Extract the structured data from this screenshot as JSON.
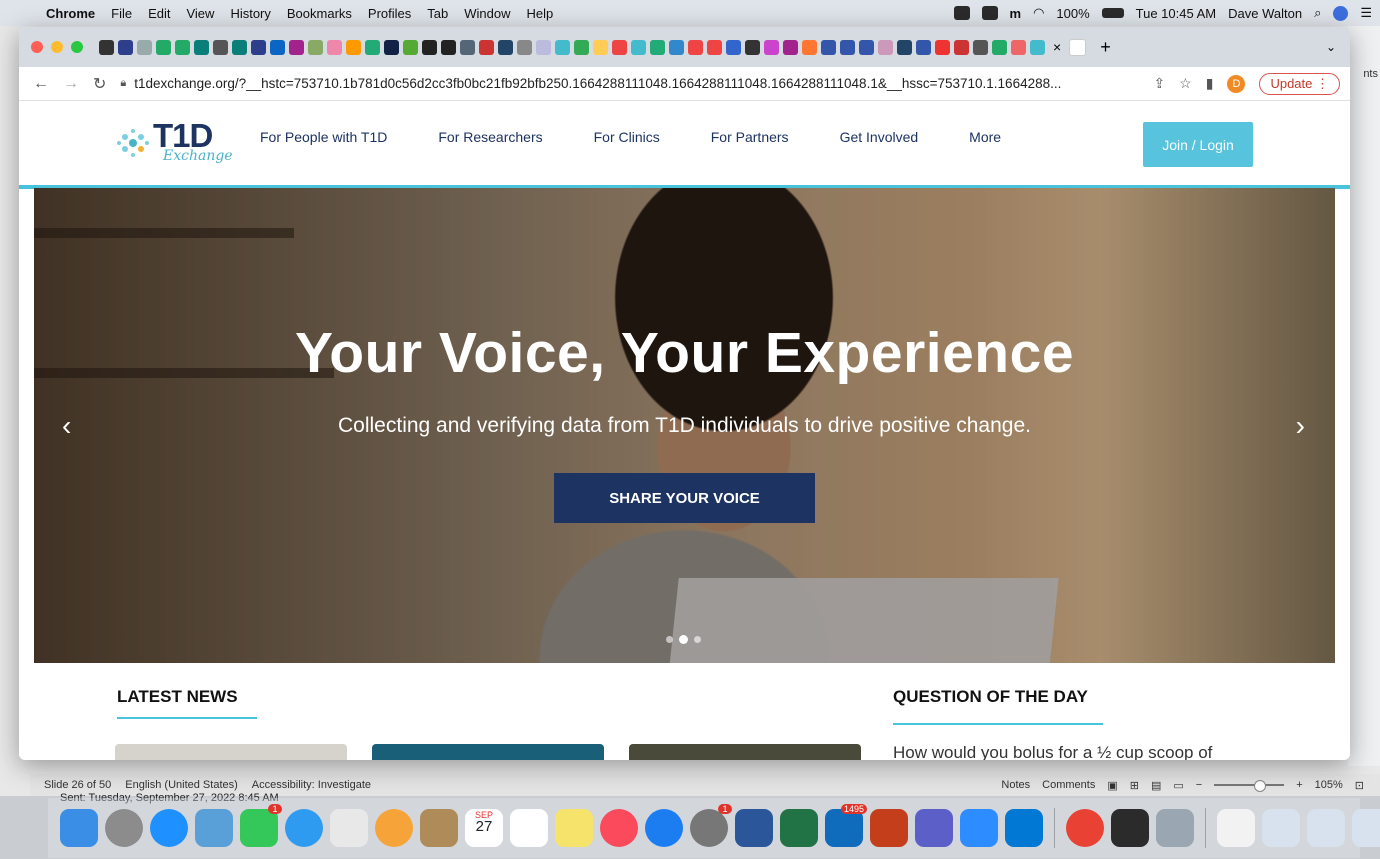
{
  "menubar": {
    "app": "Chrome",
    "items": [
      "File",
      "Edit",
      "View",
      "History",
      "Bookmarks",
      "Profiles",
      "Tab",
      "Window",
      "Help"
    ],
    "battery": "100%",
    "clock": "Tue 10:45 AM",
    "user": "Dave Walton"
  },
  "browser": {
    "url": "t1dexchange.org/?__hstc=753710.1b781d0c56d2cc3fb0bc21fb92bfb250.1664288111048.1664288111048.1664288111048.1&__hssc=753710.1.1664288...",
    "profile_initial": "D",
    "update_label": "Update"
  },
  "site": {
    "logo_main": "T1D",
    "logo_sub": "Exchange",
    "nav": [
      "For People with T1D",
      "For Researchers",
      "For Clinics",
      "For Partners",
      "Get Involved",
      "More"
    ],
    "join_label": "Join / Login",
    "hero": {
      "title": "Your Voice, Your Experience",
      "subtitle": "Collecting and verifying data from T1D individuals to drive positive change.",
      "cta": "SHARE YOUR VOICE",
      "slides_total": 3,
      "active_slide": 2
    },
    "latest_news": "LATEST NEWS",
    "question_heading": "QUESTION OF THE DAY",
    "question_text": "How would you bolus for a ½ cup scoop of"
  },
  "ppt": {
    "slide": "Slide 26 of 50",
    "language": "English (United States)",
    "accessibility": "Accessibility: Investigate",
    "notes": "Notes",
    "comments": "Comments",
    "zoom": "105%",
    "side_label": "nts",
    "sent_text": "Sent: Tuesday, September 27, 2022 8:45 AM"
  },
  "dock": {
    "badges": {
      "facetime": "1",
      "settings": "1",
      "outlook": "1495"
    },
    "calendar_month": "SEP",
    "calendar_day": "27"
  },
  "colors": {
    "brand_navy": "#1d3361",
    "brand_teal": "#49c2dc",
    "join_button": "#57c3dc"
  }
}
